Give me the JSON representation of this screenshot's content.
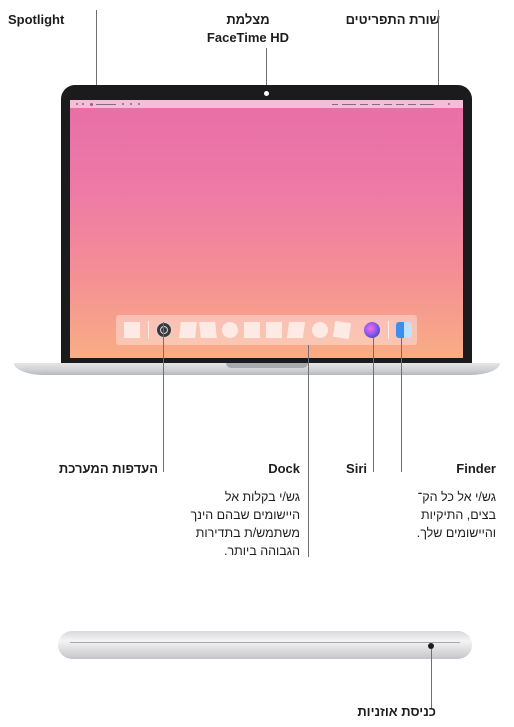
{
  "labels": {
    "spotlight": "Spotlight",
    "camera_line1": "מצלמת",
    "camera_line2": "FaceTime HD",
    "menubar": "שורת התפריטים",
    "system_prefs": "העדפות המערכת",
    "dock": "Dock",
    "siri": "Siri",
    "finder": "Finder",
    "headphone": "כניסת אוזניות"
  },
  "descriptions": {
    "dock": [
      "גש/י בקלות אל",
      "היישומים שבהם הינך",
      "משתמש/ת בתדירות",
      "הגבוהה ביותר."
    ],
    "finder": [
      "גש/י אל כל הק־",
      "בצים, התיקיות",
      "והיישומים שלך."
    ]
  },
  "colors": {
    "wallpaper_top": "#e76ea7",
    "wallpaper_bottom": "#f9ad85",
    "bezel": "#1b1b1d",
    "callout_line": "#6e6e73"
  }
}
